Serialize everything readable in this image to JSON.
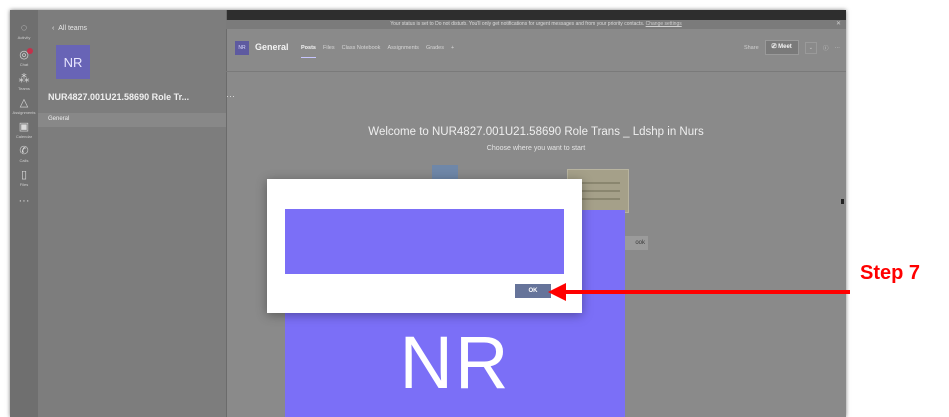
{
  "rail": {
    "items": [
      {
        "icon": "activity-icon",
        "label": "Activity",
        "glyph": "◌"
      },
      {
        "icon": "chat-icon",
        "label": "Chat",
        "glyph": "◎"
      },
      {
        "icon": "teams-icon",
        "label": "Teams",
        "glyph": "⁂"
      },
      {
        "icon": "assignments-icon",
        "label": "Assignments",
        "glyph": "△"
      },
      {
        "icon": "calendar-icon",
        "label": "Calendar",
        "glyph": "▣"
      },
      {
        "icon": "calls-icon",
        "label": "Calls",
        "glyph": "✆"
      },
      {
        "icon": "files-icon",
        "label": "Files",
        "glyph": "▯"
      },
      {
        "icon": "more-apps-icon",
        "label": "",
        "glyph": "···"
      }
    ]
  },
  "team": {
    "back_label": "All teams",
    "avatar_initials": "NR",
    "name": "NUR4827.001U21.58690 Role Tr...",
    "more": "···",
    "channels": [
      "General"
    ]
  },
  "notice": {
    "text": "Your status is set to Do not disturb. You'll only get notifications for urgent messages and from your priority contacts.",
    "link": "Change settings"
  },
  "channel_header": {
    "icon_text": "NR",
    "title": "General",
    "tabs": [
      "Posts",
      "Files",
      "Class Notebook",
      "Assignments",
      "Grades",
      "+"
    ],
    "share": "Share",
    "meet": "Meet",
    "meet_dropdown": "⌄",
    "info": "ⓘ",
    "more": "···"
  },
  "welcome": {
    "title": "Welcome to NUR4827.001U21.58690 Role Trans _ Ldshp in Nurs",
    "subtitle": "Choose where you want to start"
  },
  "notebook_button_text": "ook",
  "big_tile_initials": "NR",
  "dialog": {
    "ok_label": "OK"
  },
  "annotation": {
    "step_label": "Step 7",
    "color": "#ff0000"
  }
}
